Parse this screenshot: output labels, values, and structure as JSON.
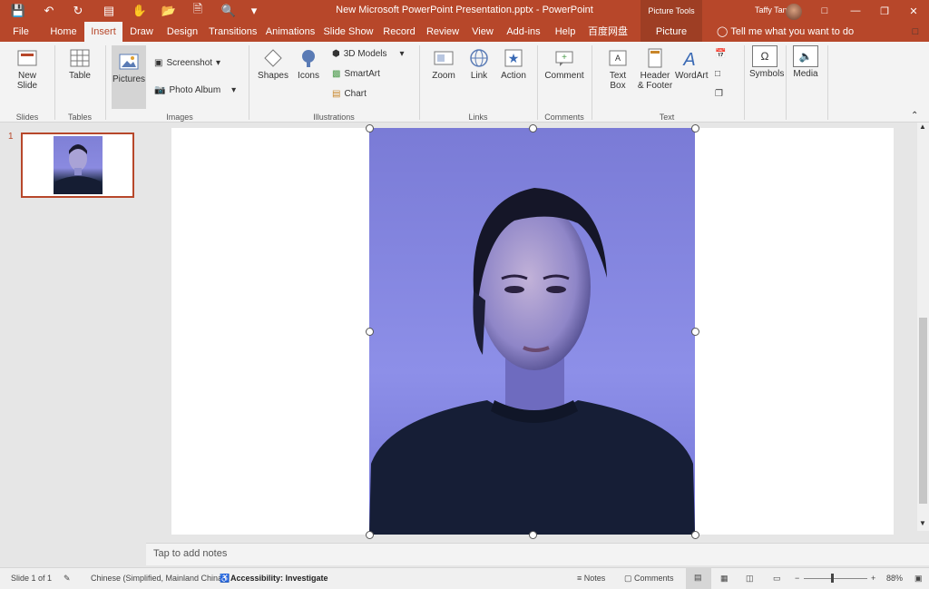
{
  "titlebar": {
    "doc_title": "New Microsoft PowerPoint Presentation.pptx - PowerPoint",
    "context_label": "Picture Tools",
    "user_name": "Taffy Tan"
  },
  "tabs": [
    {
      "label": "File"
    },
    {
      "label": "Home"
    },
    {
      "label": "Insert"
    },
    {
      "label": "Draw"
    },
    {
      "label": "Design"
    },
    {
      "label": "Transitions"
    },
    {
      "label": "Animations"
    },
    {
      "label": "Slide Show"
    },
    {
      "label": "Record"
    },
    {
      "label": "Review"
    },
    {
      "label": "View"
    },
    {
      "label": "Add-ins"
    },
    {
      "label": "百度网盘"
    },
    {
      "label": "Picture Format"
    }
  ],
  "tell_me": "Tell me what you want to do",
  "ribbon": {
    "new_slide": "New Slide",
    "table": "Table",
    "pictures": "Pictures",
    "screenshot": "Screenshot",
    "photo_album": "Photo Album",
    "shapes": "Shapes",
    "icons": "Icons",
    "models_3d": "3D Models",
    "smartart": "SmartArt",
    "chart": "Chart",
    "zoom": "Zoom",
    "link": "Link",
    "action": "Action",
    "comment": "Comment",
    "text_box": "Text Box",
    "header_footer": "Header & Footer",
    "wordart": "WordArt",
    "symbols": "Symbols",
    "media": "Media",
    "groups": {
      "slides": "Slides",
      "tables": "Tables",
      "images": "Images",
      "illustrations": "Illustrations",
      "links": "Links",
      "comments": "Comments",
      "text": "Text"
    }
  },
  "thumbnail": {
    "number": "1"
  },
  "notes_placeholder": "Tap to add notes",
  "status": {
    "slide": "Slide 1 of 1",
    "language": "Chinese (Simplified, Mainland China)",
    "accessibility": "Accessibility: Investigate",
    "notes": "Notes",
    "comments": "Comments",
    "zoom": "88%"
  },
  "colors": {
    "accent": "#b7472a",
    "photo_bg": "#8a8ce6"
  }
}
